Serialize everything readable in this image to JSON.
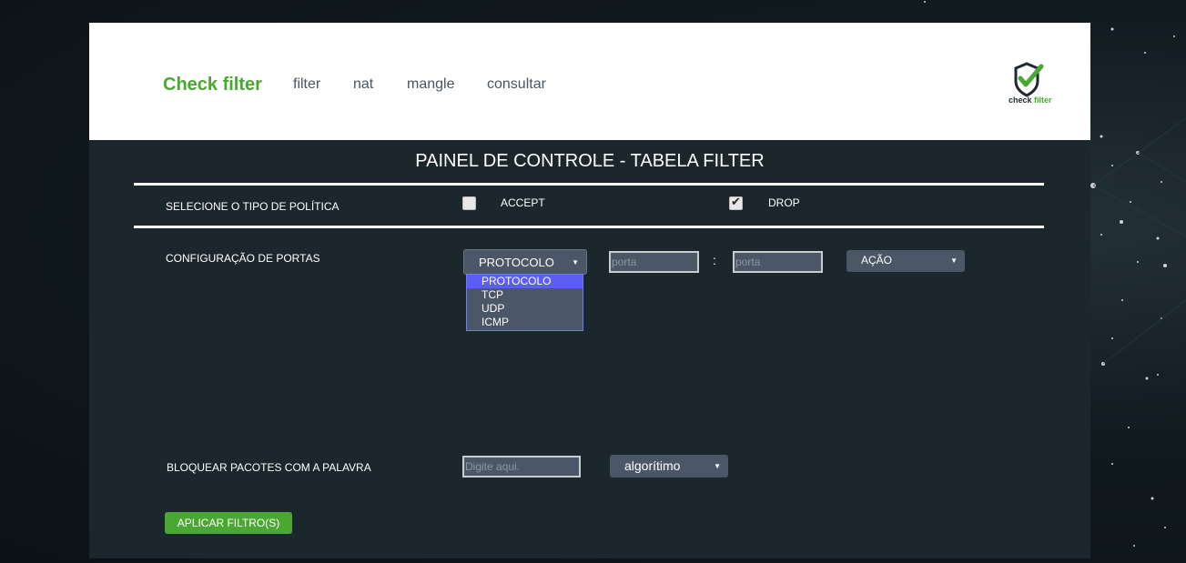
{
  "header": {
    "brand": "Check filter",
    "nav": [
      {
        "label": "filter"
      },
      {
        "label": "nat"
      },
      {
        "label": "mangle"
      },
      {
        "label": "consultar"
      }
    ],
    "logo": {
      "text_dark": "check",
      "text_accent": "filter"
    }
  },
  "panel": {
    "title": "PAINEL DE CONTROLE - TABELA FILTER",
    "policy": {
      "label": "SELECIONE O TIPO DE POLÍTICA",
      "accept_label": "ACCEPT",
      "accept_checked": false,
      "drop_label": "DROP",
      "drop_checked": true
    },
    "ports": {
      "label": "CONFIGURAÇÃO DE PORTAS",
      "protocol_value": "PROTOCOLO",
      "protocol_options": [
        "PROTOCOLO",
        "TCP",
        "UDP",
        "ICMP"
      ],
      "port_from_placeholder": "porta",
      "separator": ":",
      "port_to_placeholder": "porta",
      "action_value": "AÇÃO"
    },
    "block": {
      "label": "BLOQUEAR PACOTES COM A PALAVRA",
      "word_placeholder": "Digite aqui.",
      "algorithm_value": "algorítimo"
    },
    "apply_label": "APLICAR FILTRO(S)"
  },
  "colors": {
    "brand_green": "#4aa832",
    "panel_bg": "#1c272d",
    "control_bg": "#4b5666",
    "option_highlight": "#5b5ef0"
  }
}
